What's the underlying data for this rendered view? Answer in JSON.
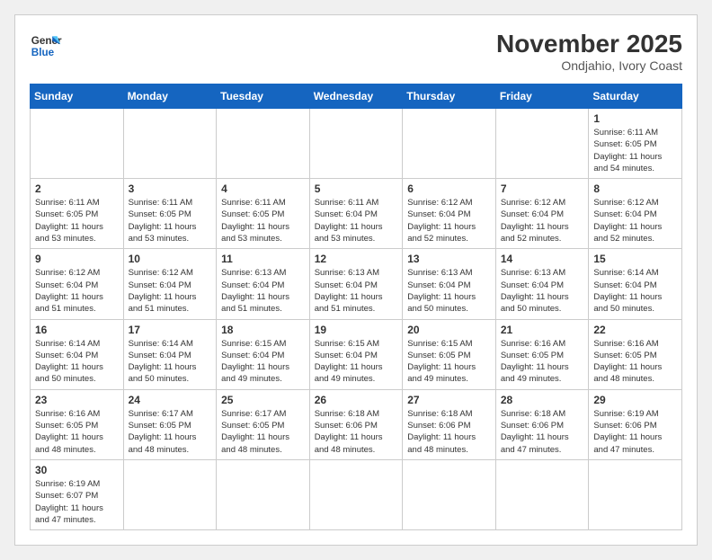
{
  "header": {
    "logo_general": "General",
    "logo_blue": "Blue",
    "month_title": "November 2025",
    "location": "Ondjahio, Ivory Coast"
  },
  "days_of_week": [
    "Sunday",
    "Monday",
    "Tuesday",
    "Wednesday",
    "Thursday",
    "Friday",
    "Saturday"
  ],
  "weeks": [
    [
      {
        "day": "",
        "info": ""
      },
      {
        "day": "",
        "info": ""
      },
      {
        "day": "",
        "info": ""
      },
      {
        "day": "",
        "info": ""
      },
      {
        "day": "",
        "info": ""
      },
      {
        "day": "",
        "info": ""
      },
      {
        "day": "1",
        "info": "Sunrise: 6:11 AM\nSunset: 6:05 PM\nDaylight: 11 hours\nand 54 minutes."
      }
    ],
    [
      {
        "day": "2",
        "info": "Sunrise: 6:11 AM\nSunset: 6:05 PM\nDaylight: 11 hours\nand 53 minutes."
      },
      {
        "day": "3",
        "info": "Sunrise: 6:11 AM\nSunset: 6:05 PM\nDaylight: 11 hours\nand 53 minutes."
      },
      {
        "day": "4",
        "info": "Sunrise: 6:11 AM\nSunset: 6:05 PM\nDaylight: 11 hours\nand 53 minutes."
      },
      {
        "day": "5",
        "info": "Sunrise: 6:11 AM\nSunset: 6:04 PM\nDaylight: 11 hours\nand 53 minutes."
      },
      {
        "day": "6",
        "info": "Sunrise: 6:12 AM\nSunset: 6:04 PM\nDaylight: 11 hours\nand 52 minutes."
      },
      {
        "day": "7",
        "info": "Sunrise: 6:12 AM\nSunset: 6:04 PM\nDaylight: 11 hours\nand 52 minutes."
      },
      {
        "day": "8",
        "info": "Sunrise: 6:12 AM\nSunset: 6:04 PM\nDaylight: 11 hours\nand 52 minutes."
      }
    ],
    [
      {
        "day": "9",
        "info": "Sunrise: 6:12 AM\nSunset: 6:04 PM\nDaylight: 11 hours\nand 51 minutes."
      },
      {
        "day": "10",
        "info": "Sunrise: 6:12 AM\nSunset: 6:04 PM\nDaylight: 11 hours\nand 51 minutes."
      },
      {
        "day": "11",
        "info": "Sunrise: 6:13 AM\nSunset: 6:04 PM\nDaylight: 11 hours\nand 51 minutes."
      },
      {
        "day": "12",
        "info": "Sunrise: 6:13 AM\nSunset: 6:04 PM\nDaylight: 11 hours\nand 51 minutes."
      },
      {
        "day": "13",
        "info": "Sunrise: 6:13 AM\nSunset: 6:04 PM\nDaylight: 11 hours\nand 50 minutes."
      },
      {
        "day": "14",
        "info": "Sunrise: 6:13 AM\nSunset: 6:04 PM\nDaylight: 11 hours\nand 50 minutes."
      },
      {
        "day": "15",
        "info": "Sunrise: 6:14 AM\nSunset: 6:04 PM\nDaylight: 11 hours\nand 50 minutes."
      }
    ],
    [
      {
        "day": "16",
        "info": "Sunrise: 6:14 AM\nSunset: 6:04 PM\nDaylight: 11 hours\nand 50 minutes."
      },
      {
        "day": "17",
        "info": "Sunrise: 6:14 AM\nSunset: 6:04 PM\nDaylight: 11 hours\nand 50 minutes."
      },
      {
        "day": "18",
        "info": "Sunrise: 6:15 AM\nSunset: 6:04 PM\nDaylight: 11 hours\nand 49 minutes."
      },
      {
        "day": "19",
        "info": "Sunrise: 6:15 AM\nSunset: 6:04 PM\nDaylight: 11 hours\nand 49 minutes."
      },
      {
        "day": "20",
        "info": "Sunrise: 6:15 AM\nSunset: 6:05 PM\nDaylight: 11 hours\nand 49 minutes."
      },
      {
        "day": "21",
        "info": "Sunrise: 6:16 AM\nSunset: 6:05 PM\nDaylight: 11 hours\nand 49 minutes."
      },
      {
        "day": "22",
        "info": "Sunrise: 6:16 AM\nSunset: 6:05 PM\nDaylight: 11 hours\nand 48 minutes."
      }
    ],
    [
      {
        "day": "23",
        "info": "Sunrise: 6:16 AM\nSunset: 6:05 PM\nDaylight: 11 hours\nand 48 minutes."
      },
      {
        "day": "24",
        "info": "Sunrise: 6:17 AM\nSunset: 6:05 PM\nDaylight: 11 hours\nand 48 minutes."
      },
      {
        "day": "25",
        "info": "Sunrise: 6:17 AM\nSunset: 6:05 PM\nDaylight: 11 hours\nand 48 minutes."
      },
      {
        "day": "26",
        "info": "Sunrise: 6:18 AM\nSunset: 6:06 PM\nDaylight: 11 hours\nand 48 minutes."
      },
      {
        "day": "27",
        "info": "Sunrise: 6:18 AM\nSunset: 6:06 PM\nDaylight: 11 hours\nand 48 minutes."
      },
      {
        "day": "28",
        "info": "Sunrise: 6:18 AM\nSunset: 6:06 PM\nDaylight: 11 hours\nand 47 minutes."
      },
      {
        "day": "29",
        "info": "Sunrise: 6:19 AM\nSunset: 6:06 PM\nDaylight: 11 hours\nand 47 minutes."
      }
    ],
    [
      {
        "day": "30",
        "info": "Sunrise: 6:19 AM\nSunset: 6:07 PM\nDaylight: 11 hours\nand 47 minutes."
      },
      {
        "day": "",
        "info": ""
      },
      {
        "day": "",
        "info": ""
      },
      {
        "day": "",
        "info": ""
      },
      {
        "day": "",
        "info": ""
      },
      {
        "day": "",
        "info": ""
      },
      {
        "day": "",
        "info": ""
      }
    ]
  ]
}
